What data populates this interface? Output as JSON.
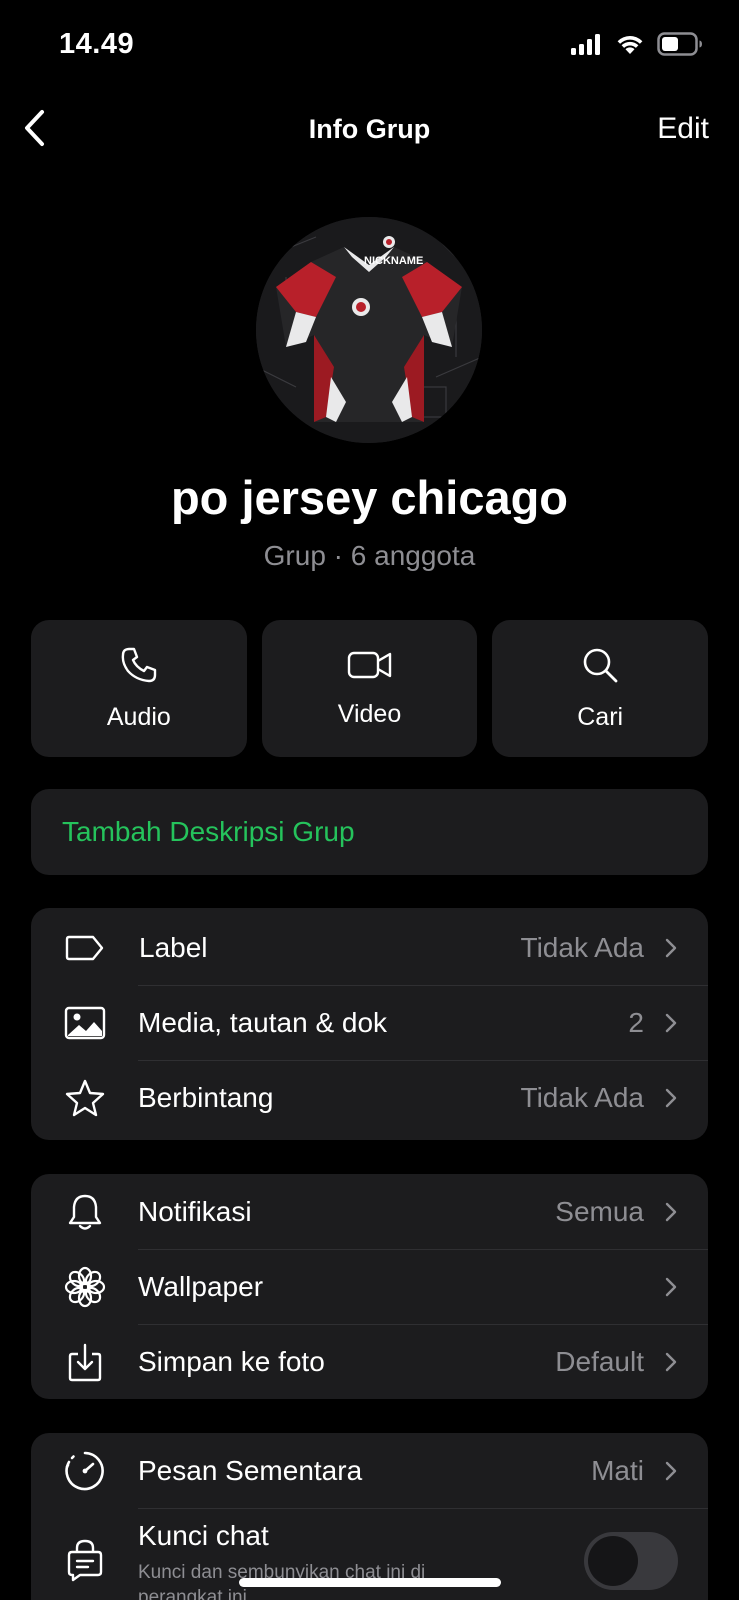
{
  "status_bar": {
    "time": "14.49",
    "icons": [
      "cellular-signal-icon",
      "wifi-icon",
      "battery-icon"
    ]
  },
  "nav": {
    "back_icon": "chevron-left-icon",
    "title": "Info Grup",
    "edit_label": "Edit"
  },
  "group": {
    "avatar": "jersey-photo",
    "avatar_text": "NICKNAME",
    "name": "po jersey chicago",
    "meta": "Grup · 6 anggota"
  },
  "actions": [
    {
      "icon": "phone-icon",
      "label": "Audio"
    },
    {
      "icon": "video-camera-icon",
      "label": "Video"
    },
    {
      "icon": "search-icon",
      "label": "Cari"
    }
  ],
  "description": {
    "label": "Tambah Deskripsi Grup",
    "color": "#25c35c"
  },
  "section1": [
    {
      "icon": "tag-icon",
      "label": "Label",
      "value": "Tidak Ada"
    },
    {
      "icon": "image-icon",
      "label": "Media, tautan & dok",
      "value": "2"
    },
    {
      "icon": "star-icon",
      "label": "Berbintang",
      "value": "Tidak Ada"
    }
  ],
  "section2": [
    {
      "icon": "bell-icon",
      "label": "Notifikasi",
      "value": "Semua"
    },
    {
      "icon": "flower-icon",
      "label": "Wallpaper",
      "value": ""
    },
    {
      "icon": "save-download-icon",
      "label": "Simpan ke foto",
      "value": "Default"
    }
  ],
  "section3": {
    "disappearing": {
      "icon": "timer-icon",
      "label": "Pesan Sementara",
      "value": "Mati"
    },
    "chat_lock": {
      "icon": "lock-chat-icon",
      "label": "Kunci chat",
      "sub": "Kunci dan sembunyikan chat ini di perangkat ini.",
      "enabled": false
    }
  },
  "colors": {
    "background": "#000000",
    "card": "#1c1c1e",
    "accent": "#25c35c",
    "secondary_text": "#8e8e93"
  }
}
